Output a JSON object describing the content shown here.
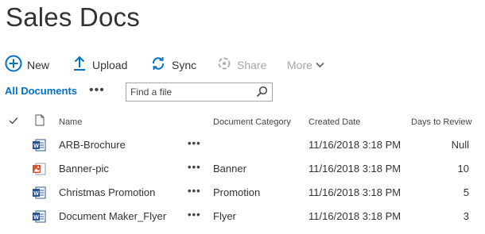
{
  "page": {
    "title": "Sales Docs"
  },
  "toolbar": {
    "new_label": "New",
    "upload_label": "Upload",
    "sync_label": "Sync",
    "share_label": "Share",
    "more_label": "More"
  },
  "viewbar": {
    "view_label": "All Documents",
    "dots": "•••",
    "search_placeholder": "Find a file"
  },
  "columns": {
    "name": "Name",
    "category": "Document Category",
    "created": "Created Date",
    "days": "Days to Review"
  },
  "rows": [
    {
      "name": "ARB-Brochure",
      "type_icon": "word-doc-icon",
      "dots": "•••",
      "category": "",
      "created": "11/16/2018 3:18 PM",
      "days": "Null"
    },
    {
      "name": "Banner-pic",
      "type_icon": "image-file-icon",
      "dots": "•••",
      "category": "Banner",
      "created": "11/16/2018 3:18 PM",
      "days": "10"
    },
    {
      "name": "Christmas Promotion",
      "type_icon": "word-doc-icon",
      "dots": "•••",
      "category": "Promotion",
      "created": "11/16/2018 3:18 PM",
      "days": "5"
    },
    {
      "name": "Document Maker_Flyer",
      "type_icon": "word-doc-icon",
      "dots": "•••",
      "category": "Flyer",
      "created": "11/16/2018 3:18 PM",
      "days": "3"
    }
  ],
  "colors": {
    "accent": "#0072c6",
    "text": "#333333",
    "disabled": "#a6a6a6"
  }
}
